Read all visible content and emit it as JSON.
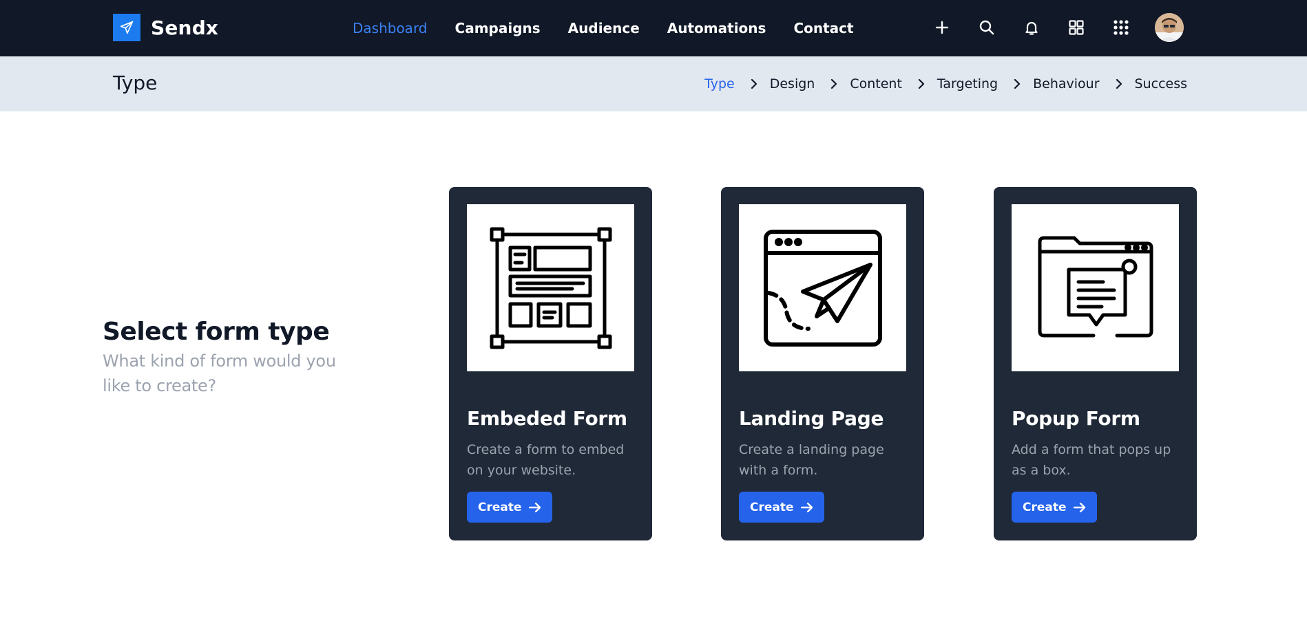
{
  "brand": {
    "name": "Sendx",
    "icon": "paper-plane-icon",
    "color": "#1d7bf0"
  },
  "nav": {
    "links": [
      {
        "label": "Dashboard",
        "active": true
      },
      {
        "label": "Campaigns",
        "active": false
      },
      {
        "label": "Audience",
        "active": false
      },
      {
        "label": "Automations",
        "active": false
      },
      {
        "label": "Contact",
        "active": false
      }
    ],
    "icons": [
      "plus-icon",
      "search-icon",
      "bell-icon",
      "grid-icon",
      "apps-icon"
    ],
    "active_color": "#3b82f6"
  },
  "stepper": {
    "title": "Type",
    "steps": [
      "Type",
      "Design",
      "Content",
      "Targeting",
      "Behaviour",
      "Success"
    ],
    "current": "Type",
    "current_color": "#2563eb"
  },
  "intro": {
    "title": "Select form type",
    "subtitle": "What kind of form would you like to create?"
  },
  "cards": [
    {
      "title": "Embeded Form",
      "description": "Create a form to embed on your website.",
      "button": "Create",
      "icon": "embedded-form-icon"
    },
    {
      "title": "Landing Page",
      "description": "Create a landing page with a form.",
      "button": "Create",
      "icon": "landing-page-icon"
    },
    {
      "title": "Popup Form",
      "description": "Add a form that pops up as a box.",
      "button": "Create",
      "icon": "popup-form-icon"
    }
  ],
  "colors": {
    "nav_bg": "#111827",
    "stepper_bg": "#e2e8f0",
    "card_bg": "#1f2937",
    "button_bg": "#2563eb"
  }
}
